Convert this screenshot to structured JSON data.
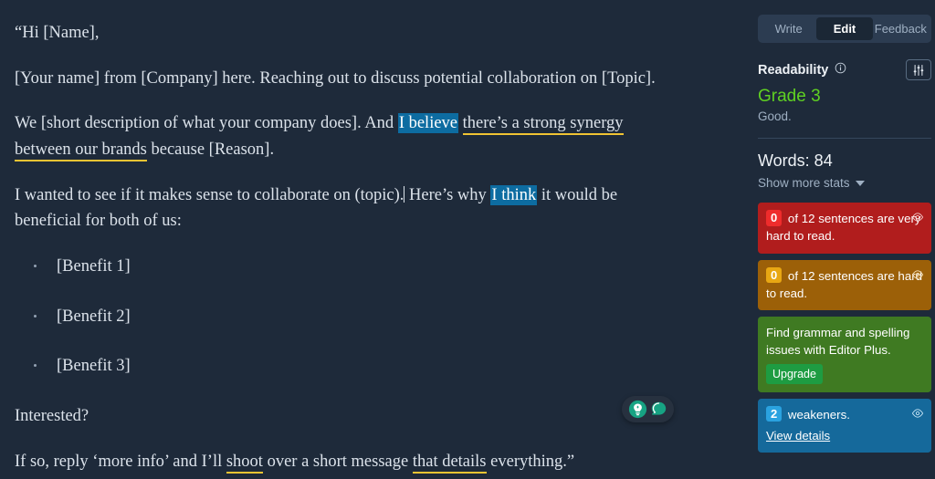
{
  "app": {
    "name": "hemingway-editor",
    "background_color": "#1e2a3a",
    "toolbar_color": "#3b4c61"
  },
  "document": {
    "paragraphs": [
      {
        "id": "greeting",
        "text": "“Hi [Name],"
      },
      {
        "id": "intro",
        "text": "[Your name] from [Company] here. Reaching out to discuss potential collaboration on [Topic]."
      },
      {
        "id": "synergy",
        "segments": [
          {
            "text": "We [short description of what your company does]. And ",
            "style": "plain"
          },
          {
            "text": "I believe",
            "style": "weakener"
          },
          {
            "text": " ",
            "style": "plain"
          },
          {
            "text": "there’s a strong synergy between our brands",
            "style": "hard-to-read"
          },
          {
            "text": " because [Reason].",
            "style": "plain"
          }
        ]
      },
      {
        "id": "collaborate",
        "segments": [
          {
            "text": "I wanted to see if it makes sense to collaborate on (topic).",
            "style": "plain"
          },
          {
            "text": "",
            "style": "caret"
          },
          {
            "text": " Here’s why ",
            "style": "plain"
          },
          {
            "text": "I think",
            "style": "weakener"
          },
          {
            "text": " it would be beneficial for both of us:",
            "style": "plain"
          }
        ]
      }
    ],
    "bullets": [
      "[Benefit 1]",
      "[Benefit 2]",
      "[Benefit 3]"
    ],
    "closing": [
      {
        "id": "interested",
        "text": "Interested?"
      },
      {
        "id": "reply",
        "segments": [
          {
            "text": "If so, reply ‘more info’ and I’ll ",
            "style": "plain"
          },
          {
            "text": "shoot",
            "style": "hard-to-read"
          },
          {
            "text": " over a short message ",
            "style": "plain"
          },
          {
            "text": "that details",
            "style": "hard-to-read"
          },
          {
            "text": " everything.”",
            "style": "plain"
          }
        ]
      }
    ],
    "highlight_colors": {
      "weakener": "#0d6ca1",
      "hard_to_read_underline": "#f0c433"
    }
  },
  "helper_pill": {
    "name": "assistant-toggle",
    "icons": [
      "lightbulb-icon",
      "speech-bubble-icon"
    ],
    "accent_color": "#17a383"
  },
  "sidebar": {
    "tabs": [
      {
        "label": "Write",
        "active": false
      },
      {
        "label": "Edit",
        "active": true
      },
      {
        "label": "Feedback",
        "active": false
      }
    ],
    "readability": {
      "title": "Readability",
      "grade": "Grade 3",
      "grade_color": "#5fd022",
      "note": "Good."
    },
    "stats": {
      "words_label": "Words: 84",
      "show_more_label": "Show more stats"
    },
    "cards": [
      {
        "id": "very-hard-sentences",
        "count": "0",
        "text": " of 12 sentences are very hard to read.",
        "color": "#b11d1d",
        "badge_color": "#ef2c2c",
        "has_eye": true
      },
      {
        "id": "hard-sentences",
        "count": "0",
        "text": " of 12 sentences are hard to read.",
        "color": "#9c6008",
        "badge_color": "#e8a713",
        "has_eye": true
      },
      {
        "id": "editor-plus-promo",
        "text": "Find grammar and spelling issues with Editor Plus.",
        "cta": "Upgrade",
        "color": "#3f7a22",
        "badge_color": "#1e9c42",
        "has_eye": false
      },
      {
        "id": "weakeners",
        "count": "2",
        "text": " weakeners.",
        "link": "View details",
        "color": "#15699b",
        "badge_color": "#2aa2e0",
        "has_eye": true
      }
    ]
  }
}
